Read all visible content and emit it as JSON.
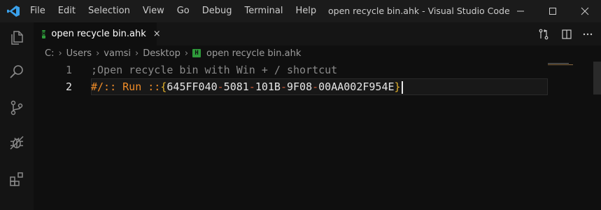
{
  "menu": [
    "File",
    "Edit",
    "Selection",
    "View",
    "Go",
    "Debug",
    "Terminal",
    "Help"
  ],
  "window_title": "open recycle bin.ahk - Visual Studio Code",
  "tab": {
    "badge": "H",
    "label": "open recycle bin.ahk",
    "close": "×"
  },
  "breadcrumb": {
    "parts": [
      "C:",
      "Users",
      "vamsi",
      "Desktop"
    ],
    "separator": "›",
    "file_badge": "H",
    "file": "open recycle bin.ahk"
  },
  "editor": {
    "lines": [
      {
        "number": "1",
        "text": ";Open recycle bin with Win + / shortcut"
      },
      {
        "number": "2",
        "text": "#/:: Run ::{645FF040-5081-101B-9F08-00AA002F954E}"
      }
    ]
  },
  "colors": {
    "comment": "#8a8a8a",
    "hotkey": "#f08c28",
    "brace": "#e2b12b",
    "guid": "#e6e6e6",
    "hyphen": "#d05a3a",
    "badge": "#2e9a3a",
    "accent": "#0e70c0"
  },
  "icons": {
    "logo": "vscode-logo-icon",
    "explorer": "files-icon",
    "search": "search-icon",
    "scm": "source-control-icon",
    "debug": "debug-icon",
    "extensions": "extensions-icon",
    "minimize": "minimize-icon",
    "maximize": "maximize-icon",
    "close": "close-icon",
    "compare": "compare-changes-icon",
    "split": "split-editor-icon",
    "more": "more-actions-icon"
  }
}
